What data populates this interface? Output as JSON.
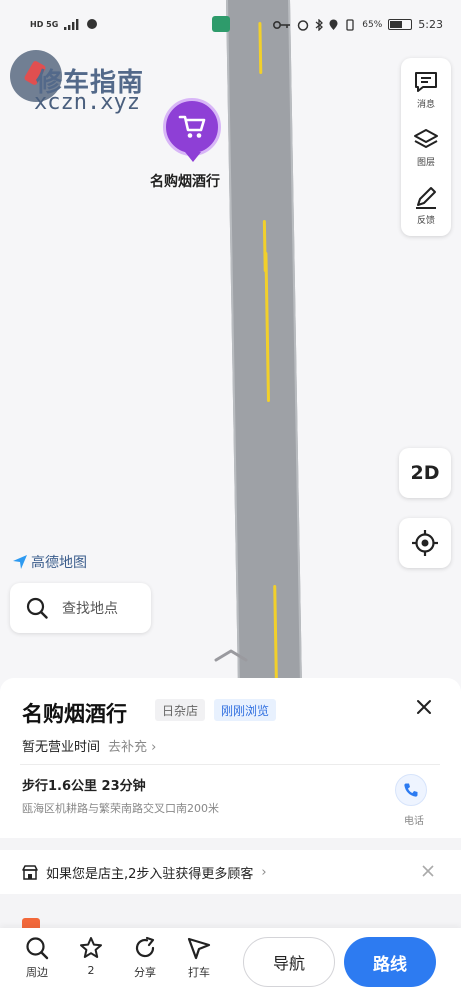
{
  "status_bar": {
    "left": "HD 5G",
    "battery_percent": "65%",
    "battery_level": 0.65,
    "time": "5:23"
  },
  "watermark": {
    "title": "修车指南",
    "subtitle": "xczn.xyz"
  },
  "map": {
    "poi_marker_label": "名购烟酒行",
    "brand": "高德地图",
    "two_d_label": "2D",
    "search_placeholder": "查找地点"
  },
  "toolbar": {
    "items": [
      {
        "label": "消息",
        "icon": "message-icon"
      },
      {
        "label": "图层",
        "icon": "layers-icon"
      },
      {
        "label": "反馈",
        "icon": "feedback-icon"
      }
    ]
  },
  "poi": {
    "name": "名购烟酒行",
    "category": "日杂店",
    "recent_tag": "刚刚浏览",
    "hours": "暂无营业时间",
    "hours_link": "去补充",
    "walk": "步行1.6公里 23分钟",
    "address": "瓯海区机耕路与繁荣南路交叉口南200米",
    "phone_label": "电话"
  },
  "owner_prompt": {
    "text": "如果您是店主,2步入驻获得更多顾客"
  },
  "bottom_bar": {
    "items": [
      {
        "label": "周边",
        "icon": "search-icon"
      },
      {
        "label": "2",
        "icon": "star-icon"
      },
      {
        "label": "分享",
        "icon": "share-icon"
      },
      {
        "label": "打车",
        "icon": "taxi-icon"
      }
    ],
    "navigate_label": "导航",
    "route_label": "路线"
  },
  "colors": {
    "accent": "#2d7bf1",
    "marker": "#8e3fd6",
    "road": "#9ea1a6",
    "lane": "#f2d02b"
  }
}
